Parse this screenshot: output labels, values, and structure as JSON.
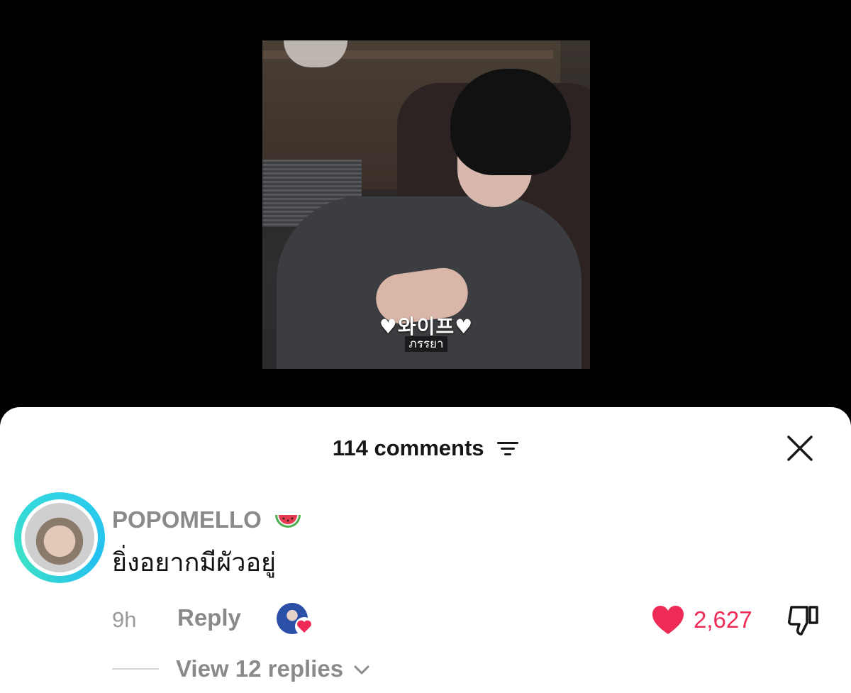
{
  "video": {
    "caption_korean": "♥와이프♥",
    "caption_thai": "ภรรยา"
  },
  "comments_sheet": {
    "title": "114 comments",
    "filter_icon": "filter-icon",
    "close_icon": "close-icon"
  },
  "comment": {
    "username": "POPOMELLO",
    "username_emoji": "watermelon-icon",
    "text": "ยิ่งอยากมีผัวอยู่",
    "time": "9h",
    "reply_label": "Reply",
    "like_count": "2,627",
    "view_replies_label": "View 12 replies",
    "avatar_ring_color": "#2fd3e6"
  },
  "colors": {
    "like_red": "#ee2a56",
    "muted_gray": "#8a8a8a"
  }
}
